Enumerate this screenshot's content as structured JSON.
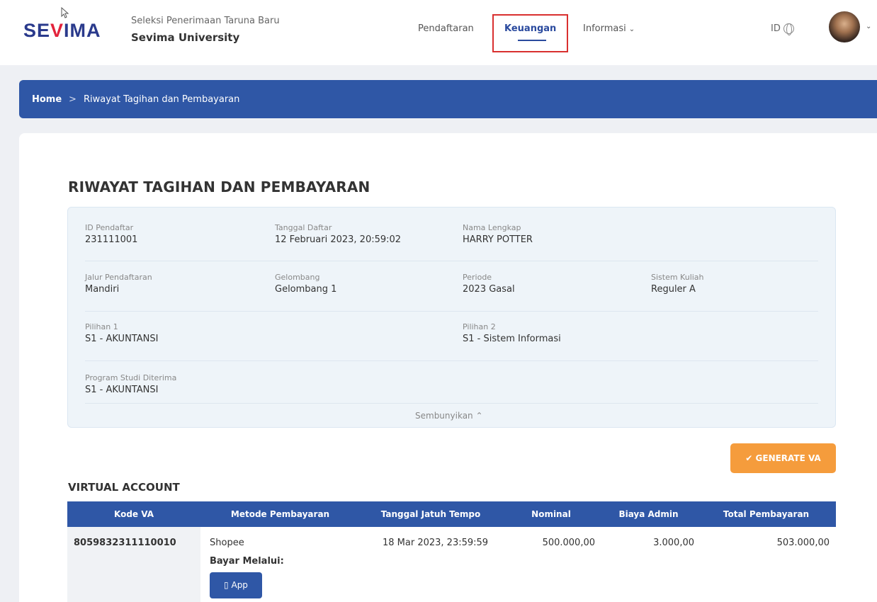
{
  "header": {
    "logo_left": "SE",
    "logo_mid": "V",
    "logo_right": "IMA",
    "subtitle": "Seleksi Penerimaan Taruna Baru",
    "title": "Sevima University",
    "nav": {
      "pendaftaran": "Pendaftaran",
      "keuangan": "Keuangan",
      "informasi": "Informasi"
    },
    "language": "ID"
  },
  "breadcrumb": {
    "home": "Home",
    "separator": ">",
    "current": "Riwayat Tagihan dan Pembayaran"
  },
  "page_title": "RIWAYAT TAGIHAN DAN PEMBAYARAN",
  "info": {
    "id_pendaftar": {
      "label": "ID Pendaftar",
      "value": "231111001"
    },
    "tanggal_daftar": {
      "label": "Tanggal Daftar",
      "value": "12 Februari 2023, 20:59:02"
    },
    "nama_lengkap": {
      "label": "Nama Lengkap",
      "value": "HARRY POTTER"
    },
    "jalur": {
      "label": "Jalur Pendaftaran",
      "value": "Mandiri"
    },
    "gelombang": {
      "label": "Gelombang",
      "value": "Gelombang 1"
    },
    "periode": {
      "label": "Periode",
      "value": "2023 Gasal"
    },
    "sistem_kuliah": {
      "label": "Sistem Kuliah",
      "value": "Reguler A"
    },
    "pilihan1": {
      "label": "Pilihan 1",
      "value": "S1 - AKUNTANSI"
    },
    "pilihan2": {
      "label": "Pilihan 2",
      "value": "S1 - Sistem Informasi"
    },
    "prodi_diterima": {
      "label": "Program Studi Diterima",
      "value": "S1 - AKUNTANSI"
    },
    "hide_label": "Sembunyikan"
  },
  "generate_va_label": "GENERATE VA",
  "va": {
    "title": "VIRTUAL ACCOUNT",
    "columns": [
      "Kode VA",
      "Metode Pembayaran",
      "Tanggal Jatuh Tempo",
      "Nominal",
      "Biaya Admin",
      "Total Pembayaran"
    ],
    "rows": [
      {
        "kode": "8059832311110010",
        "metode": "Shopee",
        "jatuh_tempo": "18 Mar 2023, 23:59:59",
        "nominal": "500.000,00",
        "biaya_admin": "3.000,00",
        "total": "503.000,00",
        "bayar_melalui": "Bayar Melalui:",
        "app_label": "App"
      }
    ]
  },
  "colors": {
    "primary": "#2f57a6",
    "accent_orange": "#f59c3c",
    "highlight_red": "#d9302f"
  }
}
